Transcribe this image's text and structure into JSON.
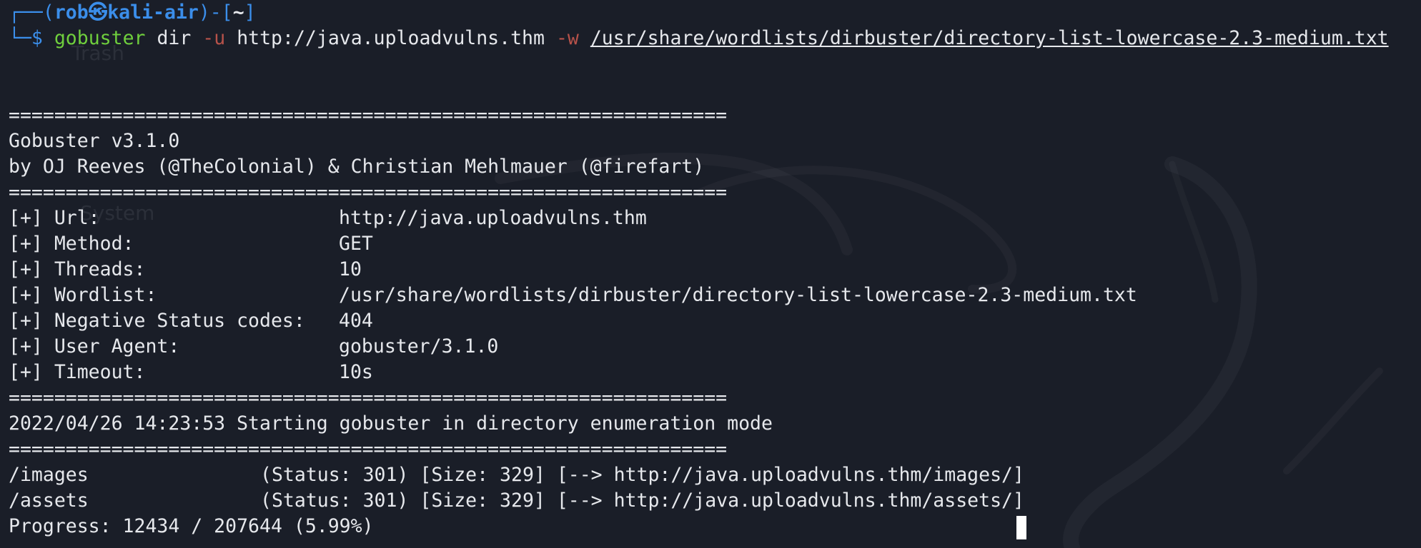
{
  "prompt": {
    "frame_top": "┌──(",
    "user": "rob",
    "at_symbol": "㉿",
    "host": "kali-air",
    "mid": ")-[",
    "dir": "~",
    "close": "]",
    "frame_bottom": "└─$",
    "command": {
      "program": "gobuster",
      "subcommand": "dir",
      "url_flag": "-u",
      "url": "http://java.uploadvulns.thm",
      "wordlist_flag": "-w",
      "wordlist_path": "/usr/share/wordlists/dirbuster/directory-list-lowercase-2.3-medium.txt"
    }
  },
  "separator": "===============================================================",
  "banner": {
    "title": "Gobuster v3.1.0",
    "authors": "by OJ Reeves (@TheColonial) & Christian Mehlmauer (@firefart)"
  },
  "config": [
    {
      "label": "[+] Url:",
      "value": "http://java.uploadvulns.thm"
    },
    {
      "label": "[+] Method:",
      "value": "GET"
    },
    {
      "label": "[+] Threads:",
      "value": "10"
    },
    {
      "label": "[+] Wordlist:",
      "value": "/usr/share/wordlists/dirbuster/directory-list-lowercase-2.3-medium.txt"
    },
    {
      "label": "[+] Negative Status codes:",
      "value": "404"
    },
    {
      "label": "[+] User Agent:",
      "value": "gobuster/3.1.0"
    },
    {
      "label": "[+] Timeout:",
      "value": "10s"
    }
  ],
  "start_message": "2022/04/26 14:23:53 Starting gobuster in directory enumeration mode",
  "results": [
    {
      "path": "/images",
      "info": "(Status: 301) [Size: 329] [--> http://java.uploadvulns.thm/images/]"
    },
    {
      "path": "/assets",
      "info": "(Status: 301) [Size: 329] [--> http://java.uploadvulns.thm/assets/]"
    }
  ],
  "progress": "Progress: 12434 / 207644 (5.99%)",
  "desktop_ghost_labels": [
    "Trash",
    "System"
  ],
  "colors": {
    "background": "#1a1e28",
    "foreground": "#e6e8ec",
    "prompt_frame": "#3b8eea",
    "command": "#6fcf3d",
    "flag": "#b7524a"
  }
}
